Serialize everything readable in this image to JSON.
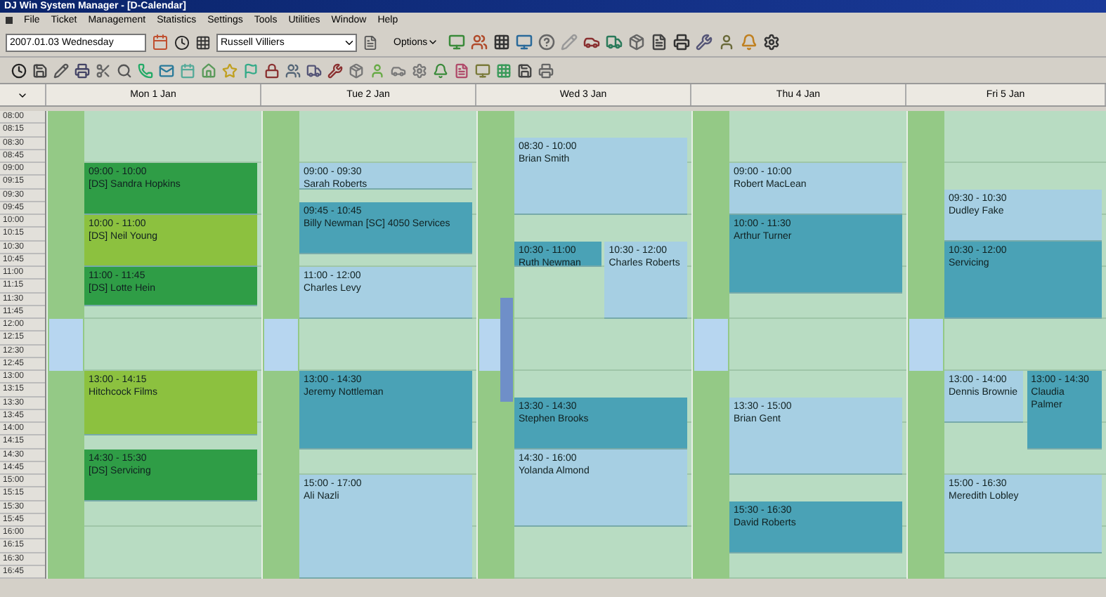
{
  "window": {
    "title": "DJ Win System Manager - [D-Calendar]"
  },
  "menu": [
    "File",
    "Ticket",
    "Management",
    "Statistics",
    "Settings",
    "Tools",
    "Utilities",
    "Window",
    "Help"
  ],
  "toolbar": {
    "date": "2007.01.03 Wednesday",
    "staff": "Russell Villiers",
    "options": "Options"
  },
  "time_labels": [
    "08:00",
    "08:15",
    "08:30",
    "08:45",
    "09:00",
    "09:15",
    "09:30",
    "09:45",
    "10:00",
    "10:15",
    "10:30",
    "10:45",
    "11:00",
    "11:15",
    "11:30",
    "11:45",
    "12:00",
    "12:15",
    "12:30",
    "12:45",
    "13:00",
    "13:15",
    "13:30",
    "13:45",
    "14:00",
    "14:15",
    "14:30",
    "14:45",
    "15:00",
    "15:15",
    "15:30",
    "15:45",
    "16:00",
    "16:15",
    "16:30",
    "16:45"
  ],
  "days": [
    {
      "label": "Mon 1 Jan",
      "events": [
        {
          "time": "09:00 - 10:00",
          "text": "[DS] Sandra Hopkins",
          "color": "#2f9d46",
          "kind": "full"
        },
        {
          "time": "10:00 - 11:00",
          "text": "[DS] Neil Young",
          "color": "#8cc13f",
          "kind": "full"
        },
        {
          "time": "11:00 - 11:45",
          "text": "[DS] Lotte Hein",
          "color": "#2f9d46",
          "kind": "full"
        },
        {
          "time": "13:00 - 14:15",
          "text": "Hitchcock Films",
          "color": "#8cc13f",
          "kind": "full"
        },
        {
          "time": "14:30 - 15:30",
          "text": "[DS] Servicing",
          "color": "#2f9d46",
          "kind": "full"
        }
      ]
    },
    {
      "label": "Tue 2 Jan",
      "events": [
        {
          "time": "09:00 - 09:30",
          "text": "Sarah Roberts",
          "color": "#a6cfe3",
          "kind": "full"
        },
        {
          "time": "09:45 - 10:45",
          "text": "Billy Newman [SC] 4050 Services",
          "color": "#4aa2b6",
          "kind": "full"
        },
        {
          "time": "11:00 - 12:00",
          "text": "Charles Levy",
          "color": "#a6cfe3",
          "kind": "full"
        },
        {
          "time": "13:00 - 14:30",
          "text": "Jeremy Nottleman",
          "color": "#4aa2b6",
          "kind": "full"
        },
        {
          "time": "15:00 - 17:00",
          "text": "Ali Nazli",
          "color": "#a6cfe3",
          "kind": "full"
        }
      ]
    },
    {
      "label": "Wed 3 Jan",
      "events": [
        {
          "time": "08:30 - 10:00",
          "text": "Brian Smith",
          "color": "#a6cfe3",
          "kind": "full"
        },
        {
          "time": "10:30 - 11:00",
          "text": "Ruth Newman",
          "color": "#4aa2b6",
          "kind": "left"
        },
        {
          "time": "10:30 - 12:00",
          "text": "Charles Roberts",
          "color": "#a6cfe3",
          "kind": "right"
        },
        {
          "time": "13:30 - 14:30",
          "text": "Stephen Brooks",
          "color": "#4aa2b6",
          "kind": "full"
        },
        {
          "time": "14:30 - 16:00",
          "text": "Yolanda Almond",
          "color": "#a6cfe3",
          "kind": "full"
        }
      ]
    },
    {
      "label": "Thu 4 Jan",
      "events": [
        {
          "time": "09:00 - 10:00",
          "text": "Robert MacLean",
          "color": "#a6cfe3",
          "kind": "full"
        },
        {
          "time": "10:00 - 11:30",
          "text": "Arthur Turner",
          "color": "#4aa2b6",
          "kind": "full"
        },
        {
          "time": "13:30 - 15:00",
          "text": "Brian Gent",
          "color": "#a6cfe3",
          "kind": "full"
        },
        {
          "time": "15:30 - 16:30",
          "text": "David Roberts",
          "color": "#4aa2b6",
          "kind": "full"
        }
      ]
    },
    {
      "label": "Fri 5 Jan",
      "events": [
        {
          "time": "09:30 - 10:30",
          "text": "Dudley Fake",
          "color": "#a6cfe3",
          "kind": "full"
        },
        {
          "time": "10:30 - 12:00",
          "text": "Servicing",
          "color": "#4aa2b6",
          "kind": "full"
        },
        {
          "time": "13:00 - 14:00",
          "text": "Dennis Brownie",
          "color": "#a6cfe3",
          "kind": "left"
        },
        {
          "time": "13:00 - 14:30",
          "text": "Claudia Palmer",
          "color": "#4aa2b6",
          "kind": "right"
        },
        {
          "time": "15:00 - 16:30",
          "text": "Meredith Lobley",
          "color": "#a6cfe3",
          "kind": "full"
        }
      ]
    }
  ]
}
